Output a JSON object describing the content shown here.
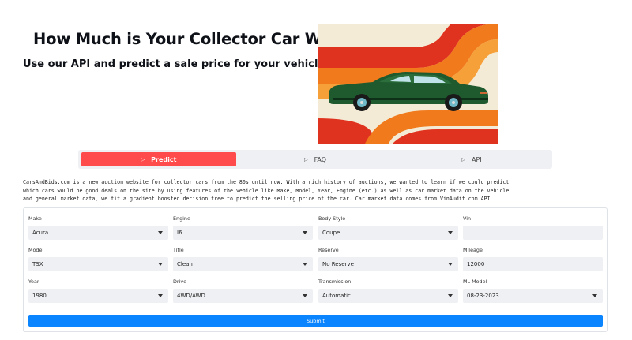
{
  "hero": {
    "title": "How Much is Your Collector Car Worth?",
    "subtitle": "Use our API and predict a sale price for your vehicle!"
  },
  "tabs": [
    {
      "label": "Predict",
      "icon": "play-icon",
      "active": true
    },
    {
      "label": "FAQ",
      "icon": "play-icon",
      "active": false
    },
    {
      "label": "API",
      "icon": "play-icon",
      "active": false
    }
  ],
  "description": {
    "line1": "CarsAndBids.com is a new auction website for collector cars from the 80s until now. With a rich history of auctions, we wanted to learn if we could predict",
    "line2": "which cars would be good deals on the site by using features of the vehicle like Make, Model, Year, Engine (etc.) as well as car market data on the vehicle",
    "line3": "and general market data, we fit a gradient boosted decision tree to predict the selling price of the car. Car market data comes from VinAudit.com API"
  },
  "form": {
    "make": {
      "label": "Make",
      "value": "Acura"
    },
    "engine": {
      "label": "Engine",
      "value": "I6"
    },
    "body_style": {
      "label": "Body Style",
      "value": "Coupe"
    },
    "vin": {
      "label": "Vin",
      "value": ""
    },
    "model": {
      "label": "Model",
      "value": "TSX"
    },
    "title": {
      "label": "Title",
      "value": "Clean"
    },
    "reserve": {
      "label": "Reserve",
      "value": "No Reserve"
    },
    "mileage": {
      "label": "Mileage",
      "value": "12000"
    },
    "year": {
      "label": "Year",
      "value": "1980"
    },
    "drive": {
      "label": "Drive",
      "value": "4WD/AWD"
    },
    "transmission": {
      "label": "Transmission",
      "value": "Automatic"
    },
    "ml_model": {
      "label": "ML Model",
      "value": "08-23-2023"
    },
    "submit_label": "Submit"
  },
  "colors": {
    "accent_red": "#ff4b4b",
    "submit_blue": "#0a84ff",
    "control_bg": "#eef0f3",
    "stripe_red": "#e0331f",
    "stripe_orange": "#f07a1c",
    "stripe_light_orange": "#f6a03a",
    "canvas_cream": "#f4ebd6",
    "car_green": "#1f5a2e"
  }
}
